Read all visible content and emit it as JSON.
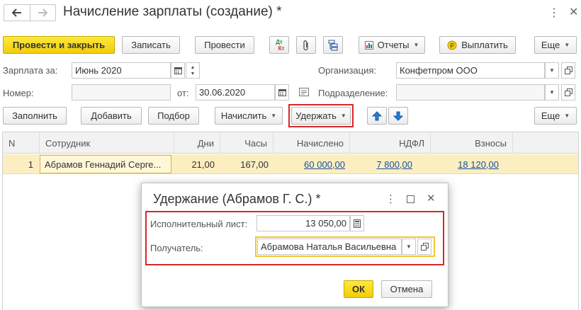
{
  "window": {
    "title": "Начисление зарплаты (создание) *",
    "back_icon": "arrow-left-icon",
    "forward_icon": "arrow-right-icon"
  },
  "toolbar": {
    "post_close": "Провести и закрыть",
    "save": "Записать",
    "post": "Провести",
    "dtkt_top": "Дт",
    "dtkt_bottom": "Кт",
    "reports": "Отчеты",
    "pay": "Выплатить",
    "more": "Еще"
  },
  "header": {
    "salary_for_label": "Зарплата за:",
    "salary_for_value": "Июнь 2020",
    "org_label": "Организация:",
    "org_value": "Конфетпром ООО",
    "number_label": "Номер:",
    "number_value": "",
    "date_label": "от:",
    "date_value": "30.06.2020",
    "division_label": "Подразделение:",
    "division_value": ""
  },
  "table_toolbar": {
    "fill": "Заполнить",
    "add": "Добавить",
    "select": "Подбор",
    "accrue": "Начислить",
    "withhold": "Удержать",
    "more": "Еще"
  },
  "table": {
    "columns": [
      "N",
      "Сотрудник",
      "Дни",
      "Часы",
      "Начислено",
      "НДФЛ",
      "Взносы"
    ],
    "rows": [
      {
        "n": "1",
        "employee": "Абрамов Геннадий Серге...",
        "days": "21,00",
        "hours": "167,00",
        "accrued": "60 000,00",
        "ndfl": "7 800,00",
        "contrib": "18 120,00"
      }
    ]
  },
  "modal": {
    "title": "Удержание (Абрамов Г. С.) *",
    "writ_label": "Исполнительный лист:",
    "writ_value": "13 050,00",
    "recipient_label": "Получатель:",
    "recipient_value": "Абрамова Наталья Васильевна",
    "ok": "ОК",
    "cancel": "Отмена"
  },
  "colors": {
    "primary_button": "#f2cc0c",
    "selected_row": "#fbeec1",
    "highlight_box": "#d62828",
    "link": "#1c4f9c"
  }
}
